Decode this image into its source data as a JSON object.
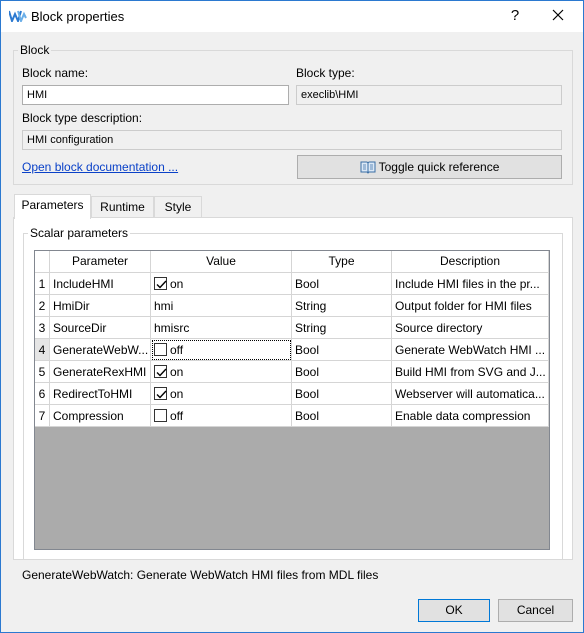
{
  "window": {
    "title": "Block properties",
    "help_label": "?",
    "close_label": "✕"
  },
  "block": {
    "group_label": "Block",
    "name_label": "Block name:",
    "name_value": "HMI",
    "type_label": "Block type:",
    "type_value": "execlib\\HMI",
    "description_label": "Block type description:",
    "description_value": "HMI configuration",
    "doc_link": "Open block documentation ...",
    "quick_ref_button": "Toggle quick reference",
    "quick_ref_icon": "book-icon"
  },
  "tabs": [
    {
      "label": "Parameters",
      "active": true
    },
    {
      "label": "Runtime",
      "active": false
    },
    {
      "label": "Style",
      "active": false
    }
  ],
  "scalar": {
    "group_label": "Scalar parameters",
    "columns": [
      "Parameter",
      "Value",
      "Type",
      "Description"
    ],
    "rows": [
      {
        "num": "1",
        "param": "IncludeHMI",
        "checkbox": true,
        "checked": true,
        "value": "on",
        "type": "Bool",
        "desc": "Include HMI files in the pr..."
      },
      {
        "num": "2",
        "param": "HmiDir",
        "checkbox": false,
        "checked": false,
        "value": "hmi",
        "type": "String",
        "desc": "Output folder for HMI files"
      },
      {
        "num": "3",
        "param": "SourceDir",
        "checkbox": false,
        "checked": false,
        "value": "hmisrc",
        "type": "String",
        "desc": "Source directory"
      },
      {
        "num": "4",
        "param": "GenerateWebW...",
        "checkbox": true,
        "checked": false,
        "value": "off",
        "type": "Bool",
        "desc": "Generate WebWatch HMI ..."
      },
      {
        "num": "5",
        "param": "GenerateRexHMI",
        "checkbox": true,
        "checked": true,
        "value": "on",
        "type": "Bool",
        "desc": "Build HMI from SVG and J..."
      },
      {
        "num": "6",
        "param": "RedirectToHMI",
        "checkbox": true,
        "checked": true,
        "value": "on",
        "type": "Bool",
        "desc": "Webserver will automatica..."
      },
      {
        "num": "7",
        "param": "Compression",
        "checkbox": true,
        "checked": false,
        "value": "off",
        "type": "Bool",
        "desc": "Enable data compression"
      }
    ]
  },
  "status_text": "GenerateWebWatch: Generate WebWatch HMI files from MDL files",
  "buttons": {
    "ok": "OK",
    "cancel": "Cancel"
  },
  "colors": {
    "accent": "#2b79d0",
    "link": "#0a41c8"
  }
}
